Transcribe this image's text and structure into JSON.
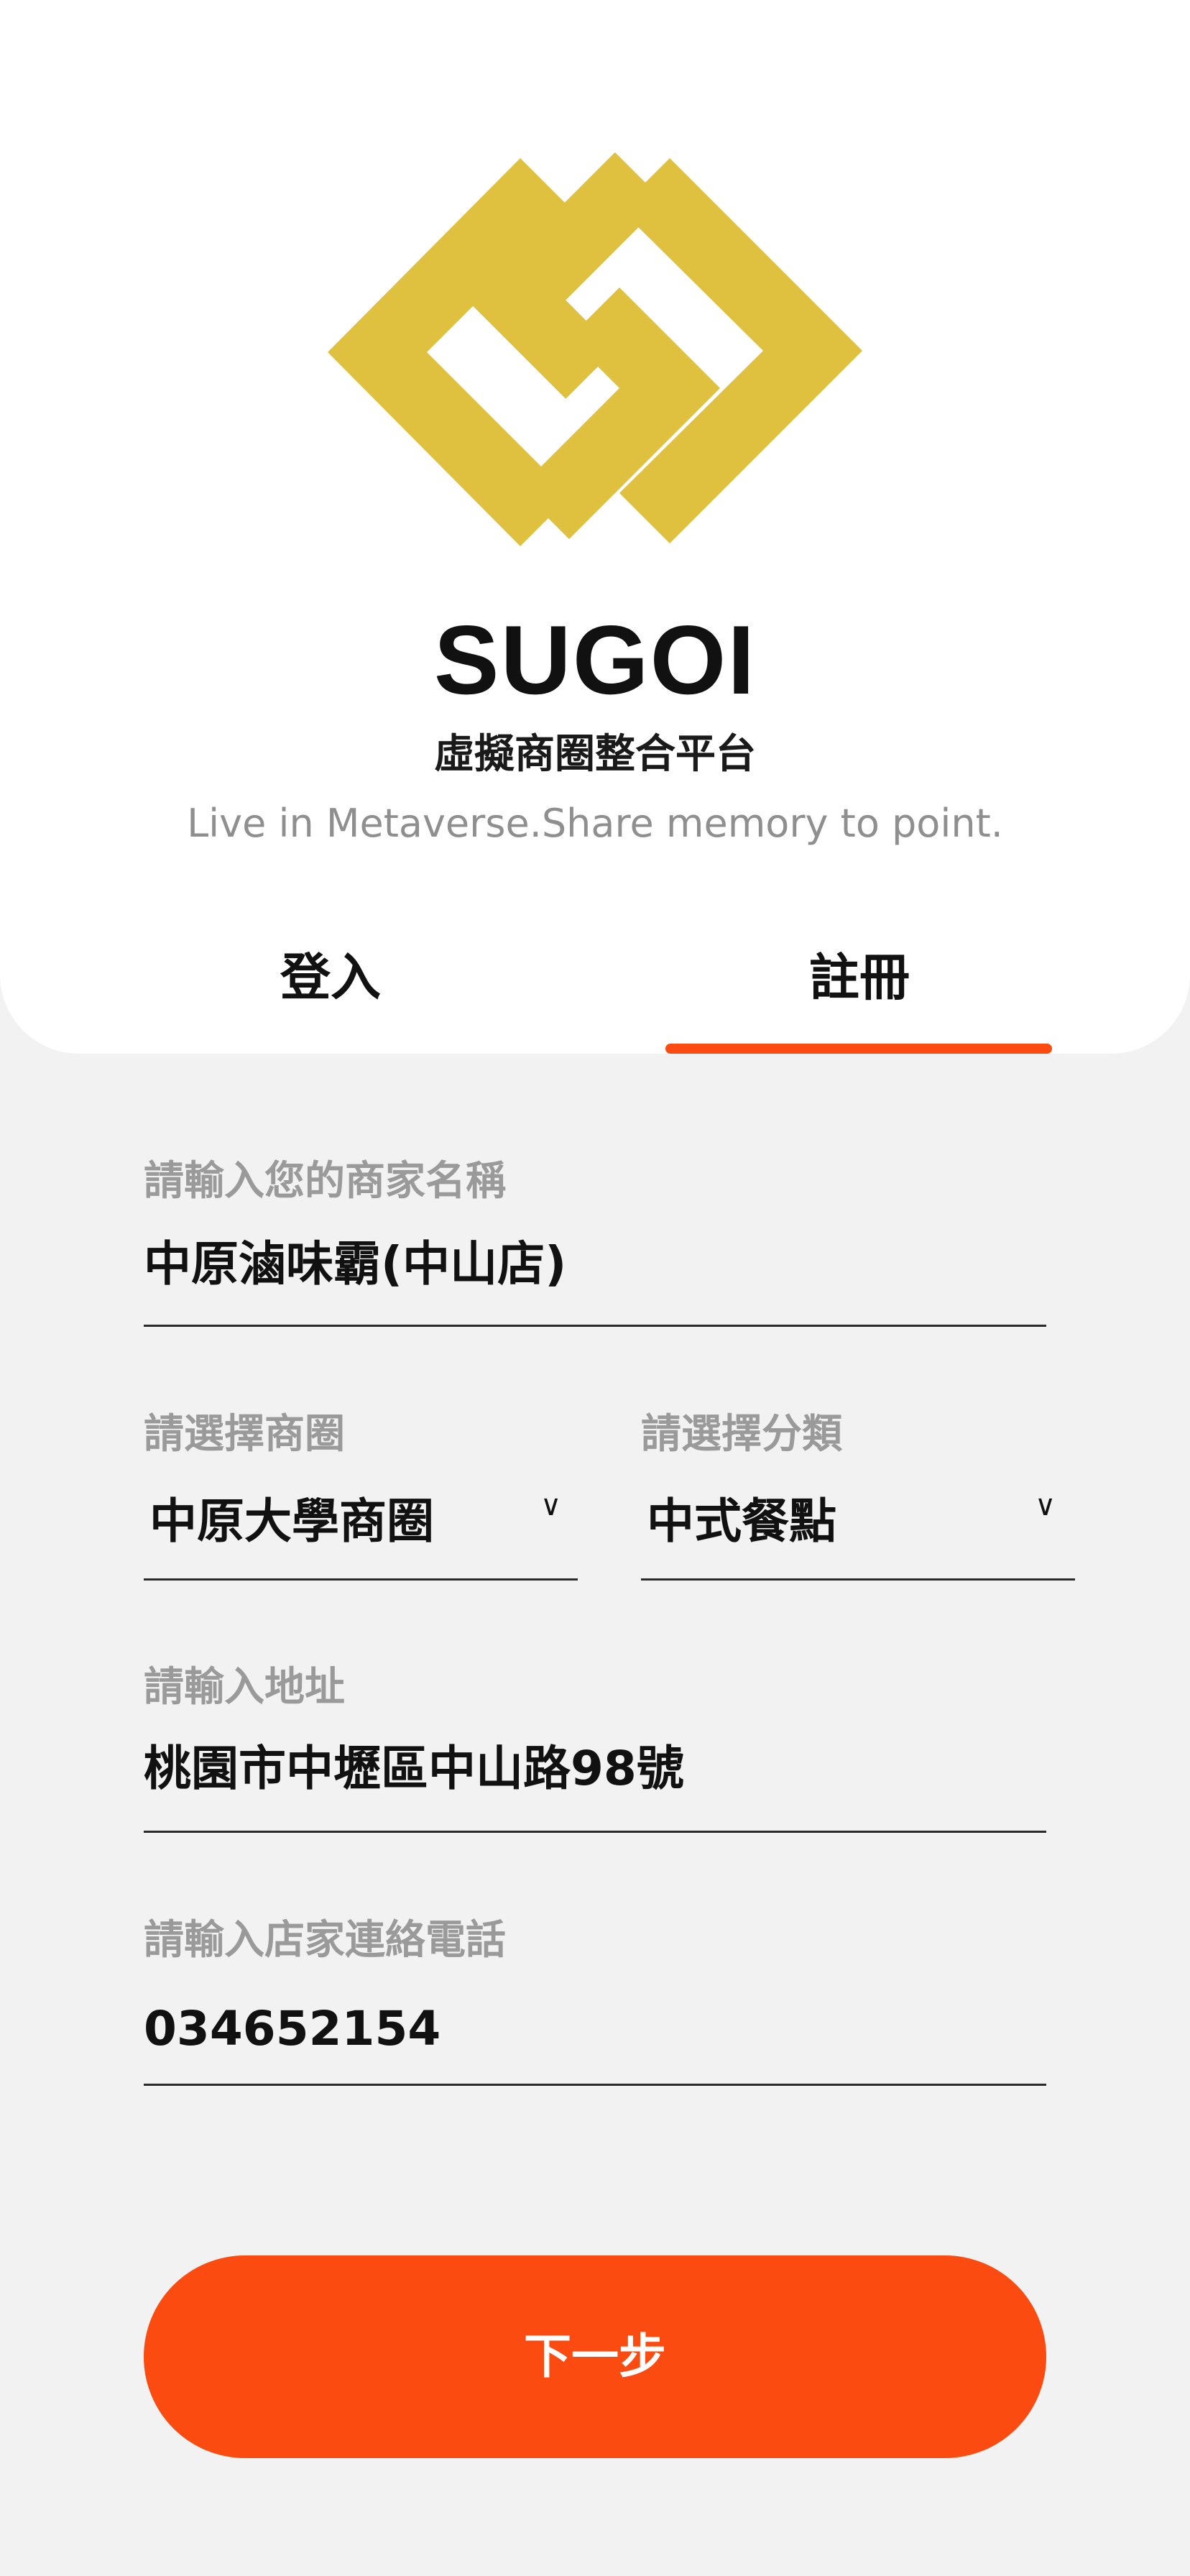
{
  "brand": {
    "title": "SUGOI",
    "subtitle": "虛擬商圈整合平台",
    "slogan": "Live in Metaverse.Share memory to point.",
    "logo_icon": "sugoi-logo-icon",
    "logo_color": "#dfc03f"
  },
  "tabs": [
    {
      "label": "登入",
      "active": false
    },
    {
      "label": "註冊",
      "active": true
    }
  ],
  "form": {
    "store_name": {
      "label": "請輸入您的商家名稱",
      "value": "中原滷味霸(中山店)"
    },
    "district": {
      "label": "請選擇商圈",
      "value": "中原大學商圈",
      "icon": "chevron-down-icon"
    },
    "category": {
      "label": "請選擇分類",
      "value": "中式餐點",
      "icon": "chevron-down-icon"
    },
    "address": {
      "label": "請輸入地址",
      "value": "桃園市中壢區中山路98號"
    },
    "phone": {
      "label": "請輸入店家連絡電話",
      "value": "034652154"
    }
  },
  "next_button": {
    "label": "下一步"
  },
  "colors": {
    "accent": "#fb4b10",
    "background": "#f2f2f2",
    "card": "#ffffff",
    "label": "#9a9a9a",
    "text": "#111111"
  }
}
